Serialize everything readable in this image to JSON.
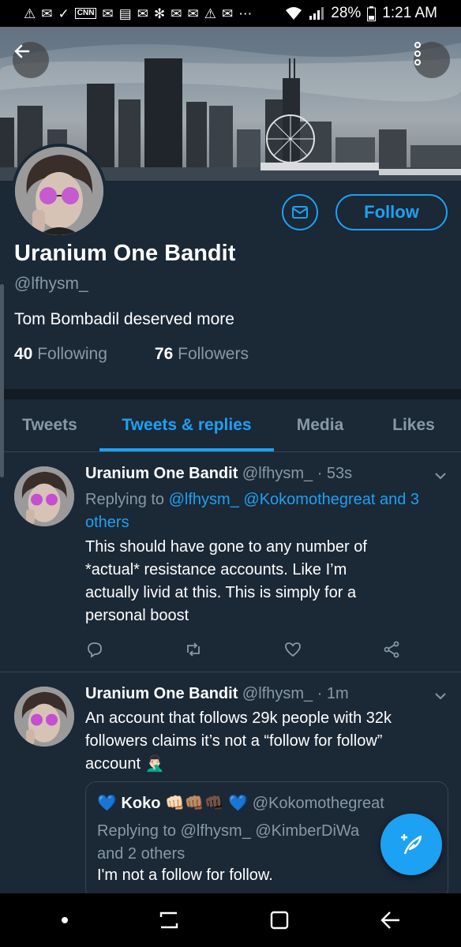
{
  "status_bar": {
    "notification_icons": [
      "⚠",
      "✉",
      "✓",
      "CNN",
      "✉",
      "▤",
      "✉",
      "✻",
      "✉",
      "✉",
      "⚠",
      "✉",
      "⋯"
    ],
    "battery": "28%",
    "time": "1:21 AM"
  },
  "profile": {
    "name": "Uranium One Bandit",
    "handle": "@lfhysm_",
    "bio": "Tom Bombadil deserved more",
    "following_count": "40",
    "following_label": "Following",
    "followers_count": "76",
    "followers_label": "Followers",
    "follow_button": "Follow"
  },
  "tabs": [
    {
      "label": "Tweets",
      "active": false
    },
    {
      "label": "Tweets & replies",
      "active": true
    },
    {
      "label": "Media",
      "active": false
    },
    {
      "label": "Likes",
      "active": false
    }
  ],
  "tweets": [
    {
      "name": "Uranium One Bandit",
      "meta": "@lfhysm_ · 53s",
      "reply_prefix": "Replying to",
      "reply_links": "@lfhysm_ @Kokomothegreat and 3 others",
      "lines": [
        "This should have gone to any number of",
        "*actual* resistance accounts. Like I’m",
        "actually livid at this. This is simply for a",
        "personal boost"
      ]
    },
    {
      "name": "Uranium One Bandit",
      "meta": "@lfhysm_ · 1m",
      "lines": [
        "An account that follows 29k people with 32k",
        "followers claims it’s not a “follow for follow”",
        "account 🤦🏻‍♂️"
      ],
      "quote": {
        "name": "💙 Koko 👊🏻👊🏽👊🏿 💙",
        "handle": "@Kokomothegreat",
        "reply_line1": "Replying to @lfhysm_ @KimberDiWa",
        "reply_line2": "and 2 others",
        "text": "I'm not a follow for follow."
      }
    }
  ],
  "colors": {
    "accent": "#1da1f2",
    "background": "#1b2836",
    "muted": "#8899a6"
  }
}
